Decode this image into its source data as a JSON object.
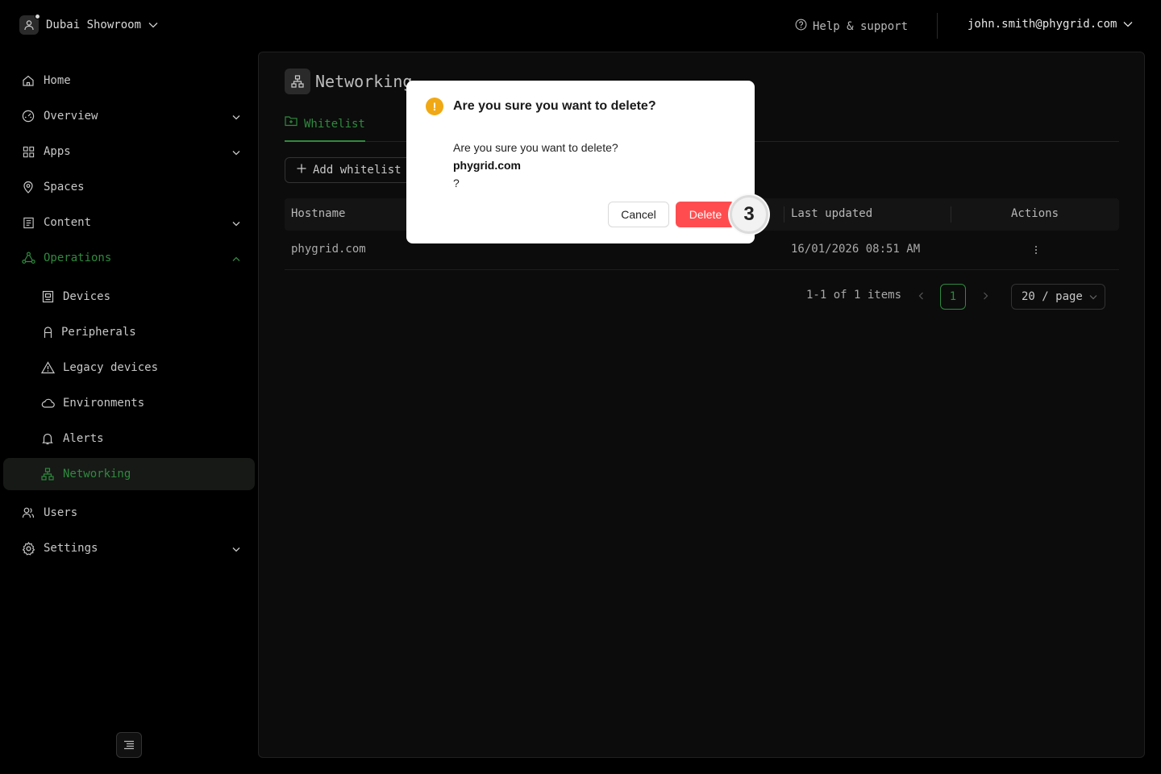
{
  "topbar": {
    "org_name": "Dubai Showroom",
    "help_label": "Help & support",
    "user_email": "john.smith@phygrid.com"
  },
  "sidebar": {
    "items": [
      {
        "label": "Home",
        "icon": "home-icon"
      },
      {
        "label": "Overview",
        "icon": "dashboard-icon",
        "expandable": true
      },
      {
        "label": "Apps",
        "icon": "apps-grid-icon",
        "expandable": true
      },
      {
        "label": "Spaces",
        "icon": "location-pin-icon"
      },
      {
        "label": "Content",
        "icon": "content-icon",
        "expandable": true
      },
      {
        "label": "Operations",
        "icon": "operations-icon",
        "expanded": true
      },
      {
        "label": "Devices",
        "icon": "device-icon",
        "sub": true
      },
      {
        "label": "Peripherals",
        "icon": "peripheral-icon",
        "sub": true
      },
      {
        "label": "Legacy devices",
        "icon": "warning-icon",
        "sub": true
      },
      {
        "label": "Environments",
        "icon": "cloud-icon",
        "sub": true
      },
      {
        "label": "Alerts",
        "icon": "bell-icon",
        "sub": true
      },
      {
        "label": "Networking",
        "icon": "network-icon",
        "sub": true,
        "active": true
      },
      {
        "label": "Users",
        "icon": "users-icon"
      },
      {
        "label": "Settings",
        "icon": "gear-icon",
        "expandable": true
      }
    ]
  },
  "page": {
    "title": "Networking",
    "tab": "Whitelist",
    "add_button": "Add whitelist",
    "columns": {
      "hostname": "Hostname",
      "last_updated": "Last updated",
      "actions": "Actions"
    },
    "rows": [
      {
        "hostname": "phygrid.com",
        "last_updated": "16/01/2026 08:51 AM"
      }
    ],
    "pagination": {
      "total": "1-1 of 1 items",
      "current_page": "1",
      "page_size": "20 / page"
    }
  },
  "modal": {
    "title": "Are you sure you want to delete?",
    "body_line1": "Are you sure you want to delete?",
    "body_item": "phygrid.com",
    "body_line3": "?",
    "cancel_label": "Cancel",
    "delete_label": "Delete",
    "step_badge": "3"
  },
  "colors": {
    "accent_green": "#2f8a3e",
    "danger": "#ff4d4f",
    "warning": "#f0a814",
    "background": "#000000"
  }
}
